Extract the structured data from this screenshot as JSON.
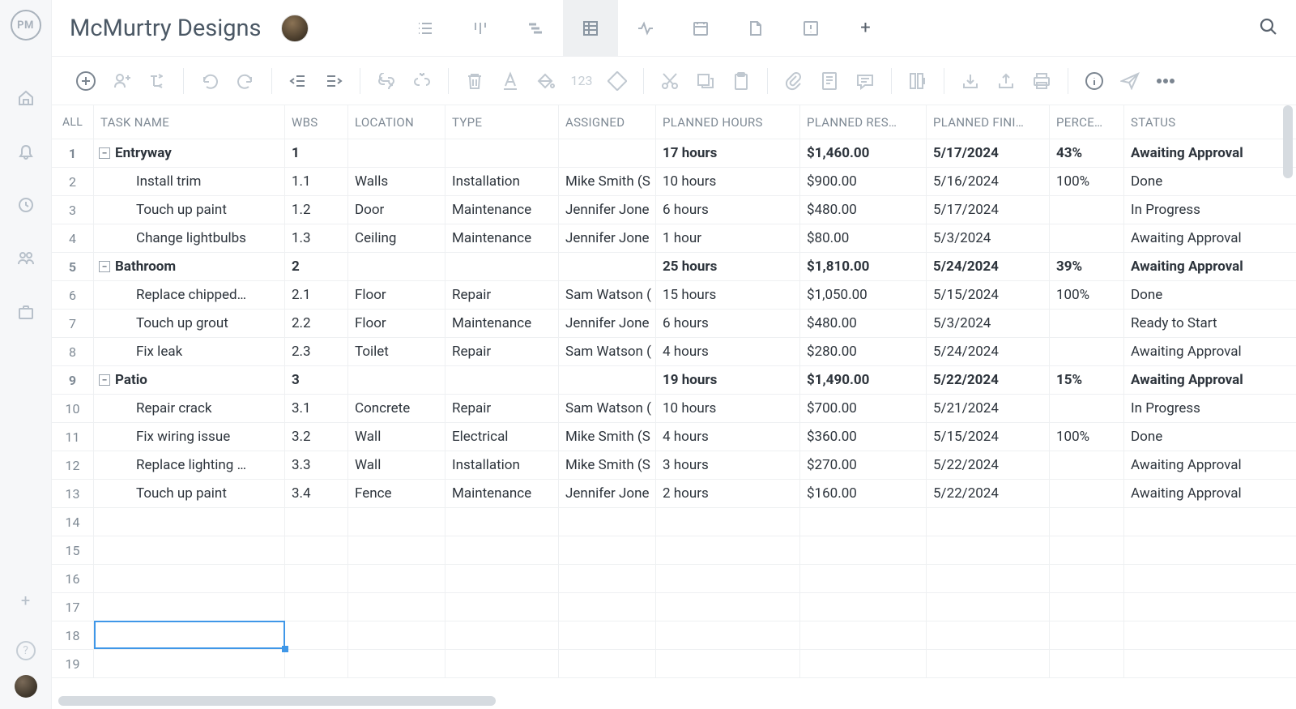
{
  "logo_text": "PM",
  "project_title": "McMurtry Designs",
  "columns": [
    {
      "key": "all",
      "label": "ALL"
    },
    {
      "key": "task",
      "label": "TASK NAME"
    },
    {
      "key": "wbs",
      "label": "WBS"
    },
    {
      "key": "loc",
      "label": "LOCATION"
    },
    {
      "key": "type",
      "label": "TYPE"
    },
    {
      "key": "assign",
      "label": "ASSIGNED"
    },
    {
      "key": "hours",
      "label": "PLANNED HOURS"
    },
    {
      "key": "cost",
      "label": "PLANNED RES…"
    },
    {
      "key": "finish",
      "label": "PLANNED FINI…"
    },
    {
      "key": "pct",
      "label": "PERCE…"
    },
    {
      "key": "status",
      "label": "STATUS"
    }
  ],
  "rows": [
    {
      "num": "1",
      "group": true,
      "color": "purple",
      "task": "Entryway",
      "wbs": "1",
      "loc": "",
      "type": "",
      "assign": "",
      "hours": "17 hours",
      "cost": "$1,460.00",
      "finish": "5/17/2024",
      "pct": "43%",
      "status": "Awaiting Approval"
    },
    {
      "num": "2",
      "group": false,
      "color": "purple",
      "task": "Install trim",
      "wbs": "1.1",
      "loc": "Walls",
      "type": "Installation",
      "assign": "Mike Smith (S",
      "hours": "10 hours",
      "cost": "$900.00",
      "finish": "5/16/2024",
      "pct": "100%",
      "status": "Done"
    },
    {
      "num": "3",
      "group": false,
      "color": "purple",
      "task": "Touch up paint",
      "wbs": "1.2",
      "loc": "Door",
      "type": "Maintenance",
      "assign": "Jennifer Jone",
      "hours": "6 hours",
      "cost": "$480.00",
      "finish": "5/17/2024",
      "pct": "",
      "status": "In Progress"
    },
    {
      "num": "4",
      "group": false,
      "color": "purple",
      "task": "Change lightbulbs",
      "wbs": "1.3",
      "loc": "Ceiling",
      "type": "Maintenance",
      "assign": "Jennifer Jone",
      "hours": "1 hour",
      "cost": "$80.00",
      "finish": "5/3/2024",
      "pct": "",
      "status": "Awaiting Approval"
    },
    {
      "num": "5",
      "group": true,
      "color": "green",
      "task": "Bathroom",
      "wbs": "2",
      "loc": "",
      "type": "",
      "assign": "",
      "hours": "25 hours",
      "cost": "$1,810.00",
      "finish": "5/24/2024",
      "pct": "39%",
      "status": "Awaiting Approval"
    },
    {
      "num": "6",
      "group": false,
      "color": "green",
      "task": "Replace chipped…",
      "wbs": "2.1",
      "loc": "Floor",
      "type": "Repair",
      "assign": "Sam Watson (",
      "hours": "15 hours",
      "cost": "$1,050.00",
      "finish": "5/15/2024",
      "pct": "100%",
      "status": "Done"
    },
    {
      "num": "7",
      "group": false,
      "color": "green",
      "task": "Touch up grout",
      "wbs": "2.2",
      "loc": "Floor",
      "type": "Maintenance",
      "assign": "Jennifer Jone",
      "hours": "6 hours",
      "cost": "$480.00",
      "finish": "5/3/2024",
      "pct": "",
      "status": "Ready to Start"
    },
    {
      "num": "8",
      "group": false,
      "color": "green",
      "task": "Fix leak",
      "wbs": "2.3",
      "loc": "Toilet",
      "type": "Repair",
      "assign": "Sam Watson (",
      "hours": "4 hours",
      "cost": "$280.00",
      "finish": "5/24/2024",
      "pct": "",
      "status": "Awaiting Approval"
    },
    {
      "num": "9",
      "group": true,
      "color": "blue",
      "task": "Patio",
      "wbs": "3",
      "loc": "",
      "type": "",
      "assign": "",
      "hours": "19 hours",
      "cost": "$1,490.00",
      "finish": "5/22/2024",
      "pct": "15%",
      "status": "Awaiting Approval"
    },
    {
      "num": "10",
      "group": false,
      "color": "blue",
      "task": "Repair crack",
      "wbs": "3.1",
      "loc": "Concrete",
      "type": "Repair",
      "assign": "Sam Watson (",
      "hours": "10 hours",
      "cost": "$700.00",
      "finish": "5/21/2024",
      "pct": "",
      "status": "In Progress"
    },
    {
      "num": "11",
      "group": false,
      "color": "blue",
      "task": "Fix wiring issue",
      "wbs": "3.2",
      "loc": "Wall",
      "type": "Electrical",
      "assign": "Mike Smith (S",
      "hours": "4 hours",
      "cost": "$360.00",
      "finish": "5/15/2024",
      "pct": "100%",
      "status": "Done"
    },
    {
      "num": "12",
      "group": false,
      "color": "blue",
      "task": "Replace lighting …",
      "wbs": "3.3",
      "loc": "Wall",
      "type": "Installation",
      "assign": "Mike Smith (S",
      "hours": "3 hours",
      "cost": "$270.00",
      "finish": "5/22/2024",
      "pct": "",
      "status": "Awaiting Approval"
    },
    {
      "num": "13",
      "group": false,
      "color": "blue",
      "task": "Touch up paint",
      "wbs": "3.4",
      "loc": "Fence",
      "type": "Maintenance",
      "assign": "Jennifer Jone",
      "hours": "2 hours",
      "cost": "$160.00",
      "finish": "5/22/2024",
      "pct": "",
      "status": "Awaiting Approval"
    },
    {
      "num": "14",
      "empty": true
    },
    {
      "num": "15",
      "empty": true
    },
    {
      "num": "16",
      "empty": true
    },
    {
      "num": "17",
      "empty": true
    },
    {
      "num": "18",
      "empty": true,
      "selected": true
    },
    {
      "num": "19",
      "empty": true
    }
  ],
  "t123_label": "123"
}
